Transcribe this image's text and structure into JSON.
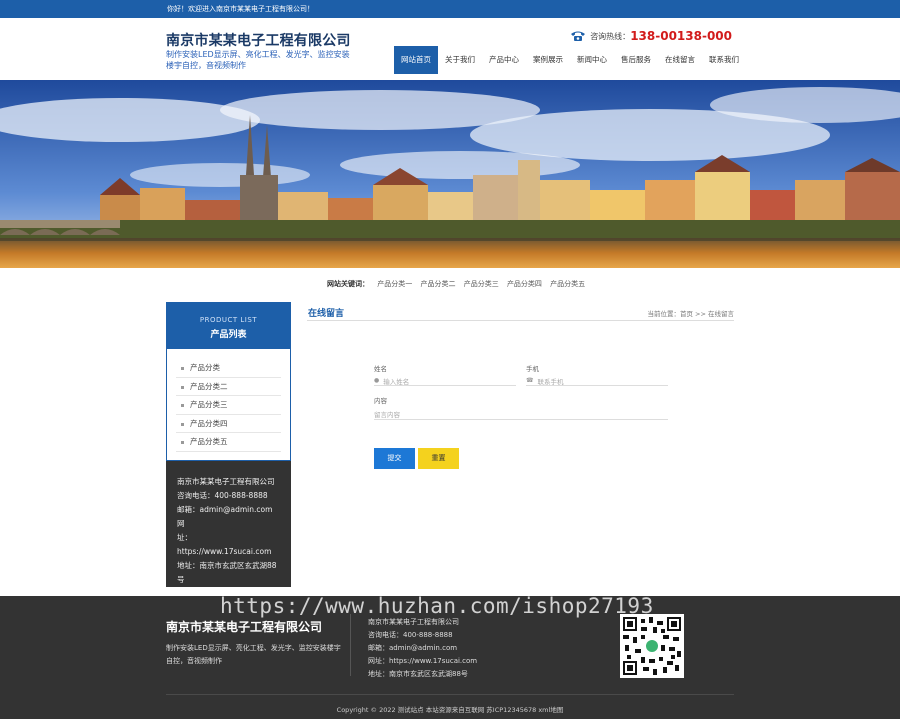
{
  "topbar": {
    "welcome": "你好！欢迎进入南京市某某电子工程有限公司！"
  },
  "header": {
    "title": "南京市某某电子工程有限公司",
    "slogan": "制作安装LED显示屏、亮化工程、发光字、监控安装楼宇自控，音视频制作",
    "hotline_label": "咨询热线：",
    "hotline_number": "138-00138-000",
    "icon": "phone-icon"
  },
  "nav": {
    "items": [
      {
        "label": "网站首页",
        "active": true
      },
      {
        "label": "关于我们"
      },
      {
        "label": "产品中心"
      },
      {
        "label": "案例展示"
      },
      {
        "label": "新闻中心"
      },
      {
        "label": "售后服务"
      },
      {
        "label": "在线留言"
      },
      {
        "label": "联系我们"
      }
    ]
  },
  "keywords": {
    "label": "网站关键词：",
    "items": [
      "产品分类一",
      "产品分类二",
      "产品分类三",
      "产品分类四",
      "产品分类五"
    ]
  },
  "sidebar": {
    "title_en": "PRODUCT LIST",
    "title_cn": "产品列表",
    "items": [
      "产品分类",
      "产品分类二",
      "产品分类三",
      "产品分类四",
      "产品分类五"
    ],
    "contact": {
      "company": "南京市某某电子工程有限公司",
      "phone": "咨询电话：400-888-8888",
      "email": "邮箱：admin@admin.com",
      "web_a": "网",
      "web_b": "址：https://www.17sucai.com",
      "addr_a": "地址：南京市玄武区玄武湖88",
      "addr_b": "号"
    }
  },
  "main": {
    "title": "在线留言",
    "breadcrumb": "当前位置：首页 >> 在线留言",
    "form": {
      "name_label": "姓名",
      "name_placeholder": "输入姓名",
      "phone_label": "手机",
      "phone_placeholder": "联系手机",
      "content_label": "内容",
      "content_placeholder": "留言内容",
      "submit": "提交",
      "reset": "重置"
    }
  },
  "footer": {
    "title": "南京市某某电子工程有限公司",
    "desc": "制作安装LED显示屏、亮化工程、发光字、监控安装楼宇自控，音视频制作",
    "company": "南京市某某电子工程有限公司",
    "phone": "咨询电话：400-888-8888",
    "email": "邮箱：admin@admin.com",
    "web": "网址：https://www.17sucai.com",
    "addr": "地址：南京市玄武区玄武湖88号",
    "copyright": "Copyright © 2022 测试站点 本站资源来自互联网  苏ICP12345678  xml地图"
  },
  "watermark": "https://www.huzhan.com/ishop27193",
  "colors": {
    "brand_blue": "#1d5fa9",
    "accent_red": "#d21b1b",
    "button_yellow": "#f4d21e",
    "footer_bg": "#333333"
  }
}
